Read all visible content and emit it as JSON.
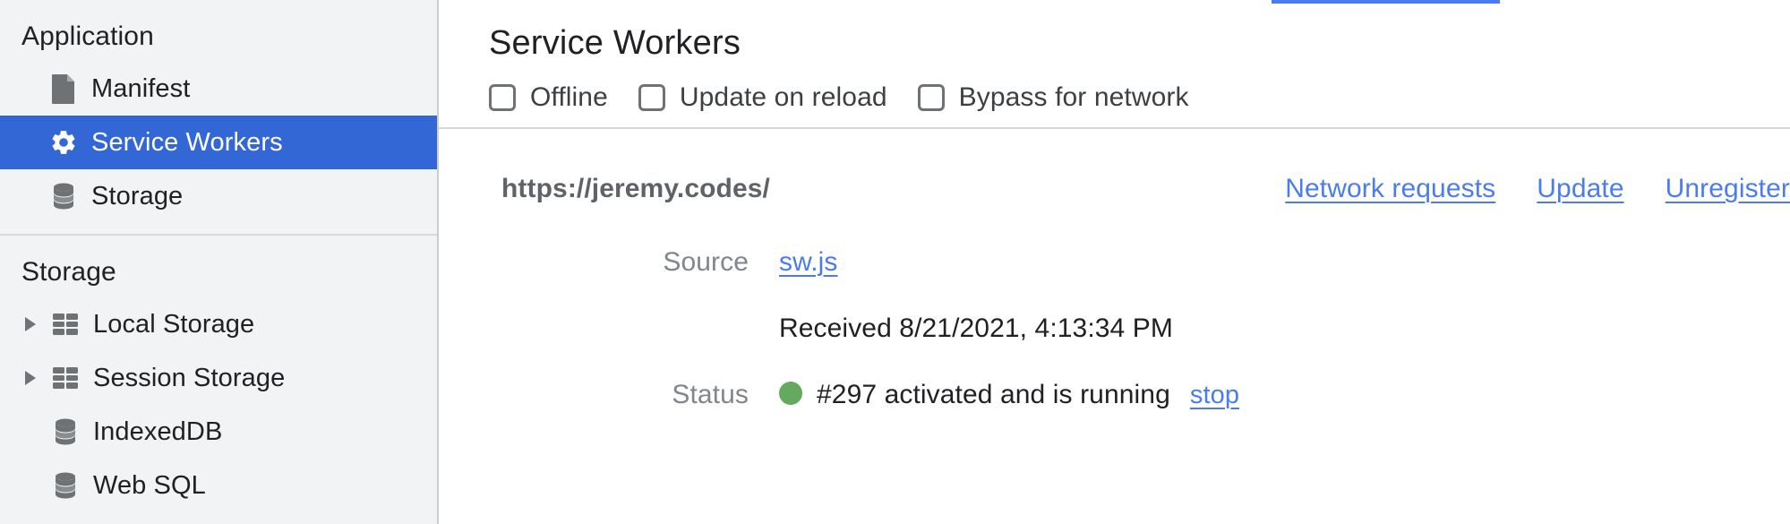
{
  "sidebar": {
    "application": {
      "header": "Application",
      "items": [
        {
          "label": "Manifest",
          "icon": "document-icon",
          "selected": false,
          "expandable": false
        },
        {
          "label": "Service Workers",
          "icon": "gear-icon",
          "selected": true,
          "expandable": false
        },
        {
          "label": "Storage",
          "icon": "database-icon",
          "selected": false,
          "expandable": false
        }
      ]
    },
    "storage": {
      "header": "Storage",
      "items": [
        {
          "label": "Local Storage",
          "icon": "table-icon",
          "selected": false,
          "expandable": true
        },
        {
          "label": "Session Storage",
          "icon": "table-icon",
          "selected": false,
          "expandable": true
        },
        {
          "label": "IndexedDB",
          "icon": "database-icon",
          "selected": false,
          "expandable": false
        },
        {
          "label": "Web SQL",
          "icon": "database-icon",
          "selected": false,
          "expandable": false
        }
      ]
    }
  },
  "main": {
    "title": "Service Workers",
    "checkboxes": [
      {
        "label": "Offline",
        "checked": false
      },
      {
        "label": "Update on reload",
        "checked": false
      },
      {
        "label": "Bypass for network",
        "checked": false
      }
    ],
    "registration": {
      "scope_url": "https://jeremy.codes/",
      "actions": [
        {
          "label": "Network requests"
        },
        {
          "label": "Update"
        },
        {
          "label": "Unregister"
        }
      ],
      "source": {
        "label": "Source",
        "file": "sw.js",
        "received": "Received 8/21/2021, 4:13:34 PM"
      },
      "status": {
        "label": "Status",
        "dot_color": "#63a95e",
        "text": "#297 activated and is running",
        "action": "stop"
      }
    }
  },
  "colors": {
    "selection_blue": "#3367d6",
    "link_blue": "#4a7cf0",
    "sidebar_bg": "#f1f3f4",
    "status_green": "#63a95e"
  }
}
